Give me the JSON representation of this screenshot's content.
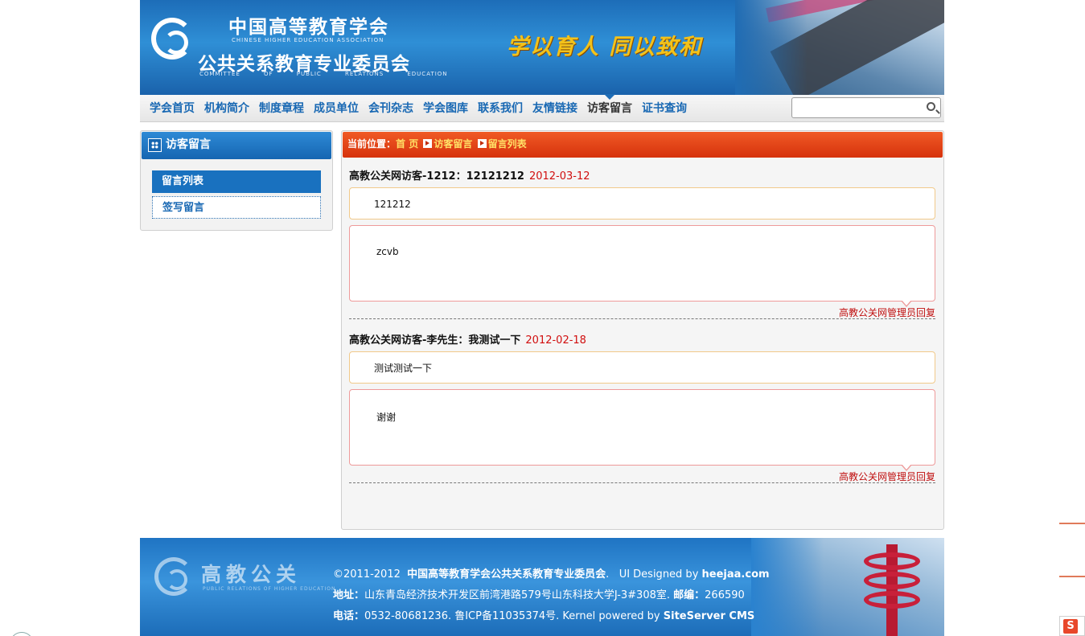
{
  "header": {
    "org_cn": "中国高等教育学会",
    "org_en": "CHINESE HIGHER EDUCATION ASSOCIATION",
    "committee_cn": "公共关系教育专业委员会",
    "committee_en": "COMMITTEE OF PUBLIC RELATIONS EDUCATION",
    "slogan": "学以育人 同以致和"
  },
  "nav": {
    "items": [
      "学会首页",
      "机构简介",
      "制度章程",
      "成员单位",
      "会刊杂志",
      "学会图库",
      "联系我们",
      "友情链接",
      "访客留言",
      "证书查询"
    ],
    "active_index": 8,
    "search_placeholder": ""
  },
  "sidebar": {
    "title": "访客留言",
    "items": [
      {
        "label": "留言列表",
        "selected": true
      },
      {
        "label": "签写留言",
        "selected": false
      }
    ]
  },
  "breadcrumb": {
    "label": "当前位置：",
    "items": [
      "首 页",
      "访客留言",
      "留言列表"
    ]
  },
  "messages": [
    {
      "title": "高教公关网访客-1212：12121212",
      "date": "2012-03-12",
      "content": "121212",
      "reply": "zcvb",
      "reply_by": "高教公关网管理员回复"
    },
    {
      "title": "高教公关网访客-李先生：我测试一下",
      "date": "2012-02-18",
      "content": "测试测试一下",
      "reply": "谢谢",
      "reply_by": "高教公关网管理员回复"
    }
  ],
  "footer": {
    "brand_cn": "高教公关",
    "brand_en": "PUBLIC RELATIONS OF HIGHER EDUCATION",
    "line1_copy": "©2011-2012",
    "line1_org": "中国高等教育学会公共关系教育专业委员会",
    "line1_sep": ".",
    "line1_ui": "UI Designed by",
    "line1_site": "heejaa.com",
    "line2_addr_label": "地址：",
    "line2_addr": "山东青岛经济技术开发区前湾港路579号山东科技大学J-3#308室.",
    "line2_zip_label": "邮编：",
    "line2_zip": "266590",
    "line3_tel_label": "电话：",
    "line3_tel": "0532-80681236. 鲁ICP备11035374号. Kernel powered by",
    "line3_cms": "SiteServer CMS"
  },
  "colors": {
    "nav_text": "#1868b3",
    "breadcrumb_bg": "#e2411a",
    "date_red": "#d10e0e",
    "sidebar_selected": "#1971bf"
  }
}
